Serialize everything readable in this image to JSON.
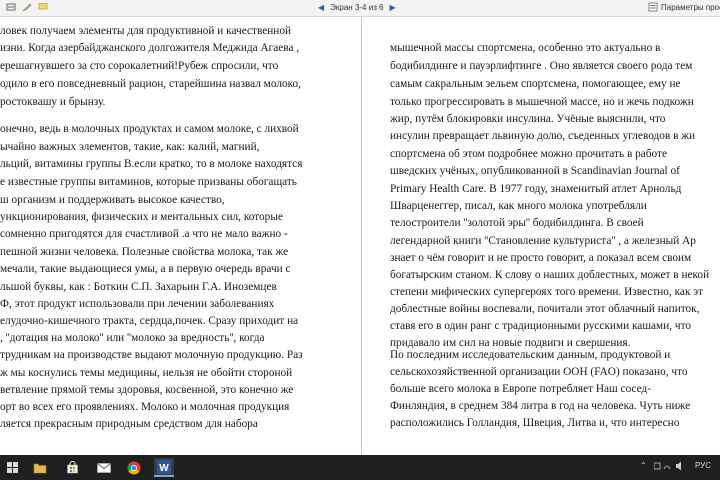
{
  "toolbar": {
    "page_indicator": "Экран 3-4 из 6",
    "view_options": "Параметры просм"
  },
  "left_page": {
    "lines": [
      "ловек получаем   элементы для продуктивной и качественной",
      "изни. Когда азербайджанского  долгожителя  Меджида Агаева ,",
      "ерешагнувшего за сто сорокалетний!Рубеж спросили, что",
      "одило в его повседневный рацион, старейшина назвал молоко,",
      "ростоквашу  и  брынзу.",
      "онечно, ведь в молочных продуктах и самом молоке, с лихвой",
      "ычайно важных элементов, такие, как: калий, магний,",
      "льций, витамины группы В.если кратко, то в молоке находятся",
      "е известные группы витаминов, которые призваны обогащать",
      "ш организм и поддерживать высокое качество,",
      "ункционирования, физических и ментальных сил, которые",
      "сомненно пригодятся для  счастливой .а что не мало важно -",
      "пешной жизни человека. Полезные свойства молока, так же",
      "мечали, такие выдающиеся умы, а в первую очередь врачи с",
      "льшой буквы, как :  Боткин С.П. Захарьин Г.А.  Иноземцев",
      "Ф, этот продукт  использовали при лечении заболеваниях",
      "елудочно-кишечного тракта, сердца,почек. Сразу приходит на",
      ", ''дотация на молоко'' или ''молоко за вредность'', когда",
      "трудникам на производстве выдают молочную продукцию. Раз",
      "ж мы коснулись темы медицины, нельзя не обойти стороной",
      "ветвление прямой темы здоровья, косвенной, это конечно же",
      "орт во всех его проявлениях. Молоко и молочная продукция",
      "ляется прекрасным природным средством для набора"
    ]
  },
  "right_page": {
    "lines": [
      "мышечной массы спортсмена, особенно это актуально в",
      "бодибилдинге и пауэрлифтинге . Оно является своего рода тем",
      "самым сакральным зельем спортсмена, помогающее, ему не",
      "только прогрессировать в мышечной массе, но и жечь подкожн",
      "жир, путём блокировки инсулина.  Учёные выяснили, что",
      "инсулин  превращает  львиную долю, съеденных углеводов в жи",
      "спортсмена об этом подробнее можно прочитать в работе",
      "шведских учёных, опубликованной в Scandinavian Journal of",
      "Primary Health Care. В 1977 году, знаменитый атлет Арнольд",
      "Шварценеггер,  писал, как много молока употребляли",
      "телостроители  ''золотой эры'' бодибилдинга.  В своей",
      "легендарной книги ''Становление культуриста'' , а железный Ар",
      "знает о чём говорит и не просто говорит, а показал всем своим",
      "богатырским станом. К слову о наших доблестных, может в некой",
      "степени мифических супергероях того времени. Известно, как эт",
      "доблестные войны воспевали, почитали этот облачный напиток,",
      "ставя его в один ранг с традиционными русскими кашами, что",
      "придавало им сил на новые подвиги и свершения.",
      "По последним исследовательским данным, продуктовой и",
      "сельскохозяйственной организации ООН (FAO) показано, что",
      "больше всего молока в Европе потребляет Наш сосед-",
      "Финляндия, в среднем 384 литра в год на человека. Чуть ниже",
      "расположились Голландия, Швеция, Литва и, что интересно"
    ]
  },
  "taskbar": {
    "language": "РУС"
  },
  "colors": {
    "taskbar": "#1f1f1f",
    "toolbar": "#f3f3f3",
    "word_blue": "#2b579a"
  }
}
